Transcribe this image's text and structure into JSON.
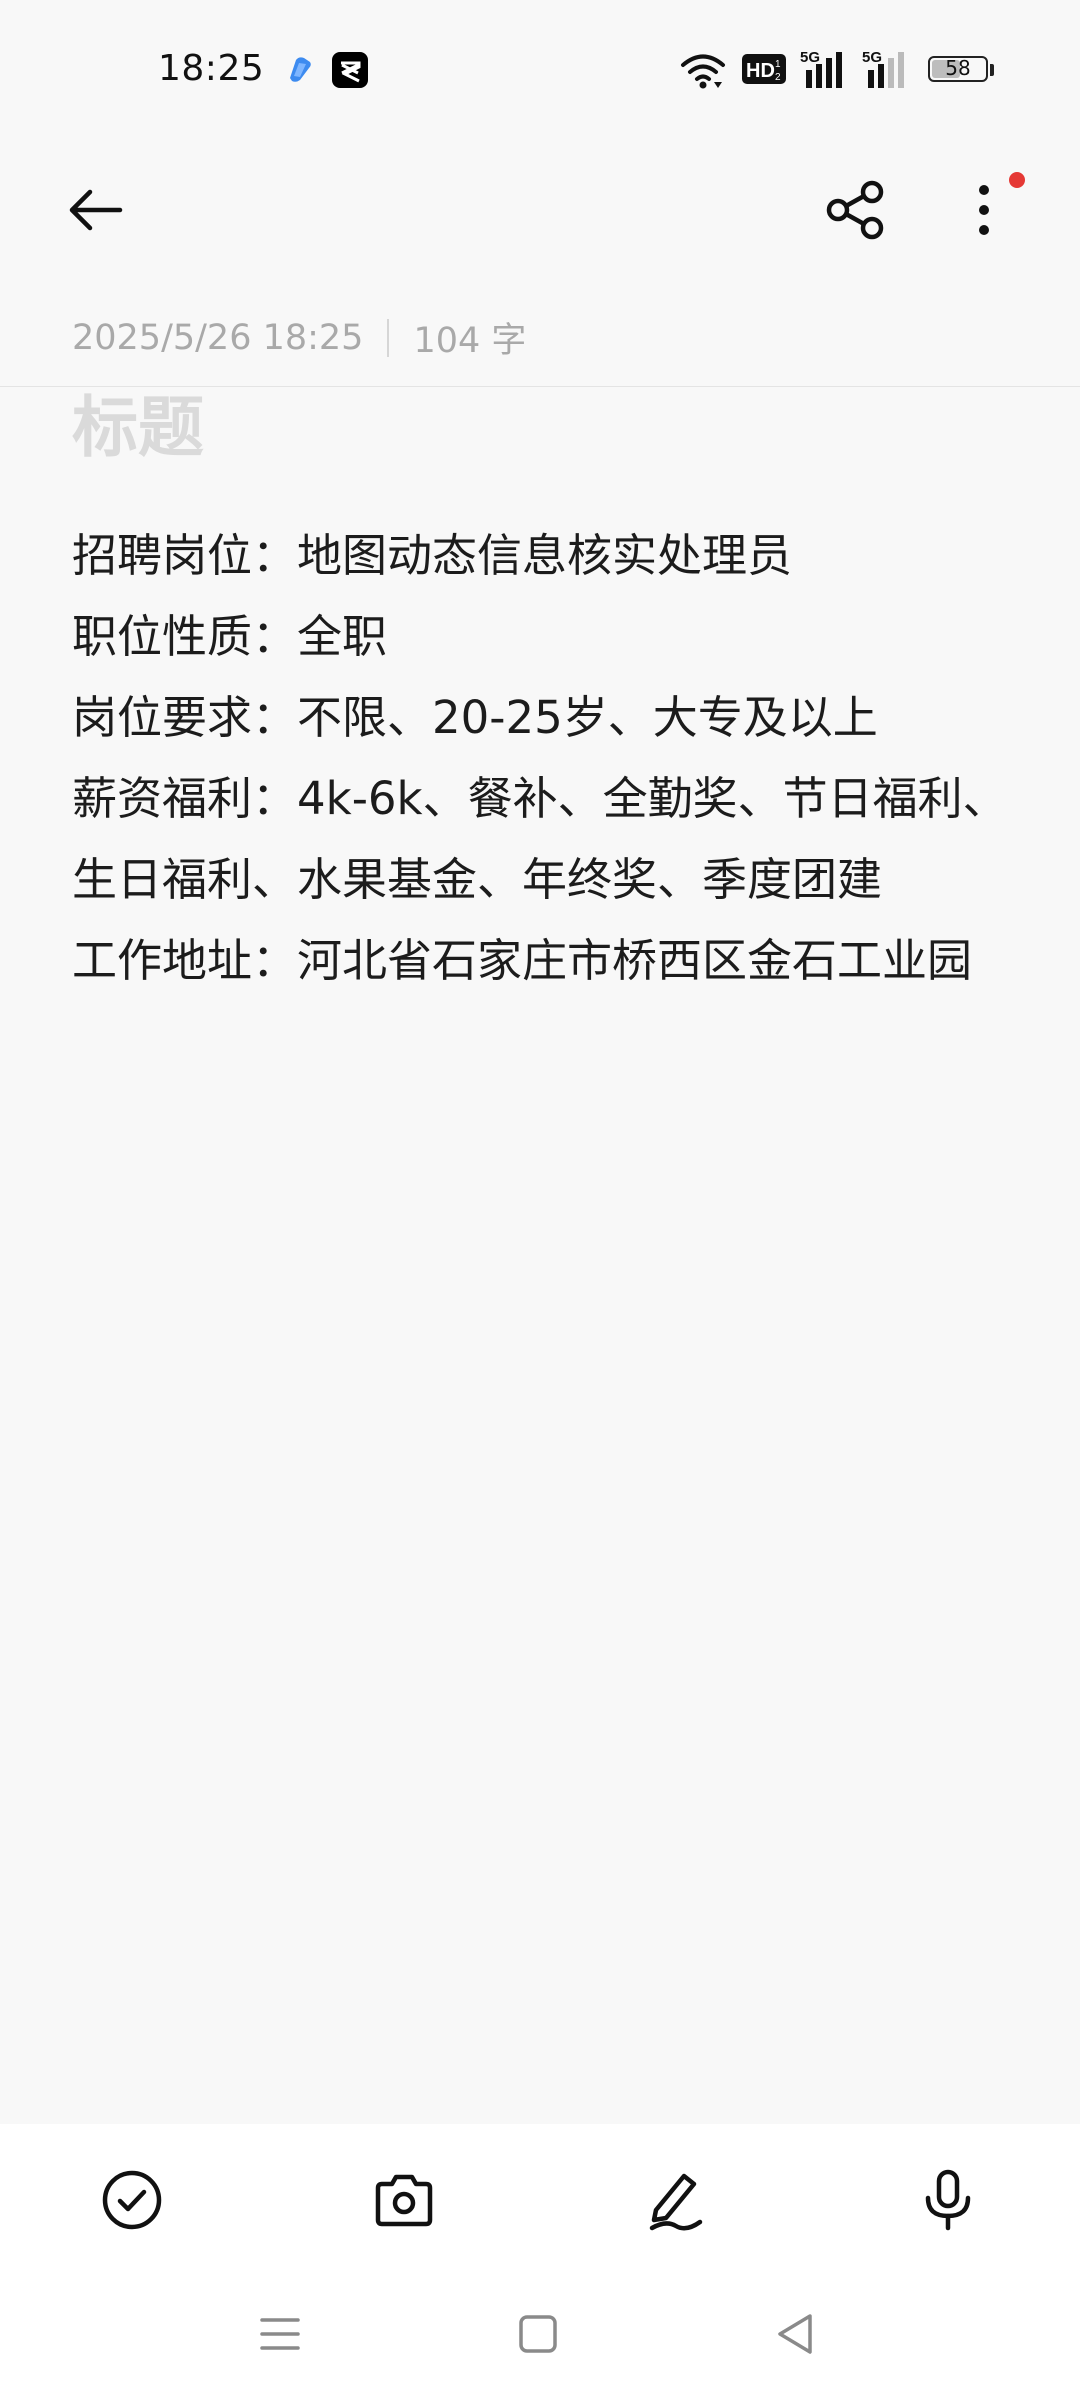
{
  "status_bar": {
    "time": "18:25",
    "battery_level": "58",
    "network_badge": "HD",
    "signal_1_label": "5G",
    "signal_2_label": "5G",
    "icons": [
      "blue-app-icon",
      "capcut-icon",
      "wifi-icon",
      "hd-icon",
      "signal-icon",
      "signal-icon",
      "battery-icon"
    ]
  },
  "toolbar": {
    "back_icon": "arrow-left-icon",
    "share_icon": "share-icon",
    "more_icon": "more-vertical-icon",
    "has_notification_dot": true
  },
  "note": {
    "date": "2025/5/26 18:25",
    "word_count": "104 字",
    "title_placeholder": "标题",
    "lines": [
      "招聘岗位：地图动态信息核实处理员",
      "职位性质：全职",
      "岗位要求：不限、20-25岁、大专及以上",
      "薪资福利：4k-6k、餐补、全勤奖、节日福利、生日福利、水果基金、年终奖、季度团建",
      "工作地址：河北省石家庄市桥西区金石工业园"
    ]
  },
  "bottom_toolbar": {
    "items": [
      "checklist-icon",
      "camera-icon",
      "handwriting-icon",
      "microphone-icon"
    ]
  },
  "nav_bar": {
    "items": [
      "menu-icon",
      "home-icon",
      "back-triangle-icon"
    ]
  },
  "colors": {
    "background": "#f8f8f8",
    "text": "#1c1c1c",
    "meta_text": "#a9a9a9",
    "placeholder": "#dadada",
    "notification_dot": "#e53935"
  }
}
